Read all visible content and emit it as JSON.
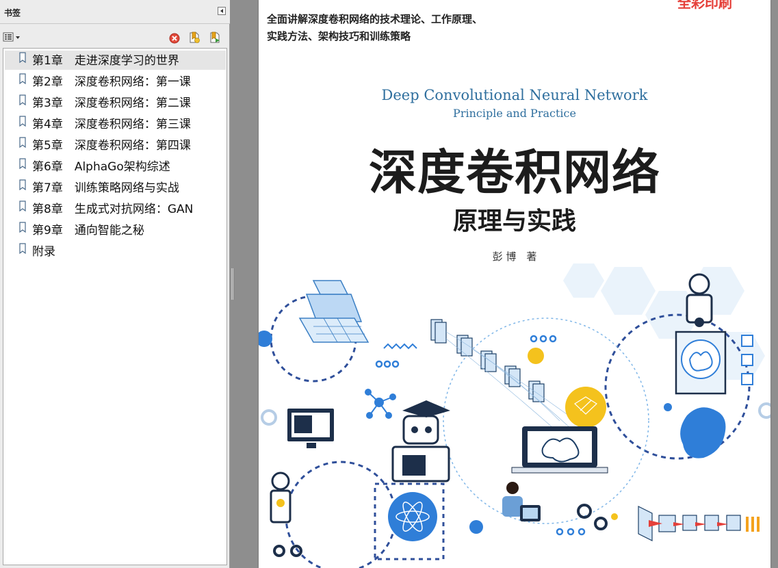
{
  "panel": {
    "title": "书签",
    "bookmarks": [
      {
        "label": "第1章　走进深度学习的世界"
      },
      {
        "label": "第2章　深度卷积网络：第一课"
      },
      {
        "label": "第3章　深度卷积网络：第二课"
      },
      {
        "label": "第4章　深度卷积网络：第三课"
      },
      {
        "label": "第5章　深度卷积网络：第四课"
      },
      {
        "label": "第6章　AlphaGo架构综述"
      },
      {
        "label": "第7章　训练策略网络与实战"
      },
      {
        "label": "第8章　生成式对抗网络：GAN"
      },
      {
        "label": "第9章　通向智能之秘"
      },
      {
        "label": "附录"
      }
    ],
    "selected_index": 0
  },
  "cover": {
    "stamp": "全彩印刷",
    "tagline_1": "全面讲解深度卷积网络的技术理论、工作原理、",
    "tagline_2": "实践方法、架构技巧和训练策略",
    "english_title": "Deep Convolutional Neural Network",
    "english_subtitle": "Principle and Practice",
    "chinese_title": "深度卷积网络",
    "chinese_subtitle": "原理与实践",
    "author": "彭 博　著"
  },
  "colors": {
    "accent_blue": "#2f6f9e",
    "art_blue": "#2f7ed8",
    "art_yellow": "#f4c21d",
    "stamp_red": "#e5403a"
  }
}
